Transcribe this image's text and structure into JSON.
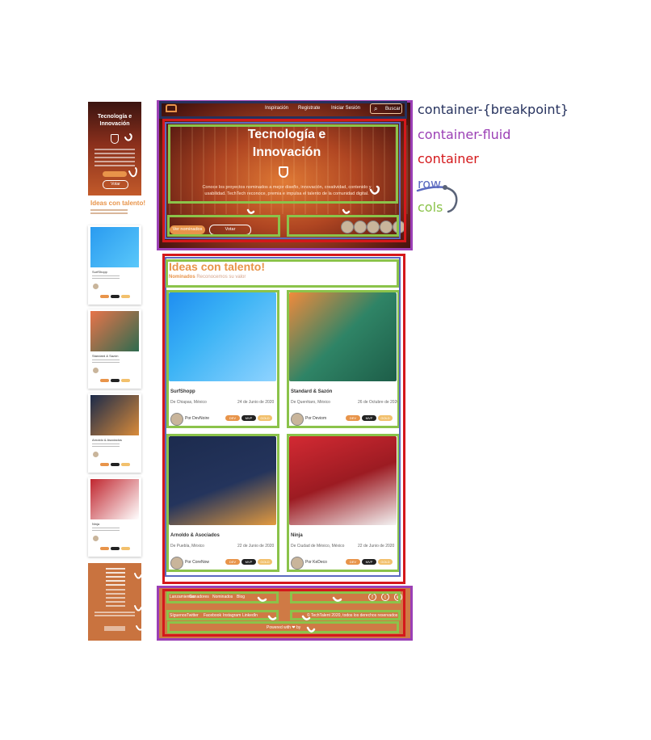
{
  "colors": {
    "container_breakpoint": "#26325e",
    "container_fluid": "#9b3fb5",
    "container": "#d4181b",
    "row": "#5b6ac0",
    "cols": "#8bc34a",
    "accent": "#e8944a"
  },
  "legend": {
    "container_breakpoint": "container-{breakpoint}",
    "container_fluid": "container-fluid",
    "container": "container",
    "row": "row",
    "cols": "cols"
  },
  "nav": {
    "items": [
      "Inspiración",
      "Registrate",
      "Iniciar Sesión"
    ],
    "search": "Buscar"
  },
  "hero": {
    "title": "Tecnología e Innovación",
    "body": "Conoce los proyectos nominados a mejor diseño, innovación, creatividad, contenido y usabilidad. TechTech reconoce, premia e impulsa el talento de la comunidad digital.",
    "primary_button": "Ver nominados",
    "secondary_button": "Votar"
  },
  "ideas": {
    "title": "Ideas con talento!",
    "subtitle_strong": "Nominados",
    "subtitle": "Reconocemos su valor"
  },
  "cards": [
    {
      "name": "SurfShopp",
      "location": "De Chiapas, México",
      "date": "24 de Junio de 2020",
      "author": "Por DevNoire"
    },
    {
      "name": "Standard & Sazón",
      "location": "De Querétaro, México",
      "date": "26 de Octubre de 2020",
      "author": "Por Deviom"
    },
    {
      "name": "Arnoldo & Asociados",
      "location": "De Puebla, México",
      "date": "22 de Junio de 2020",
      "author": "Por CoreNow"
    },
    {
      "name": "Ninja",
      "location": "De Ciudad de México, México",
      "date": "22 de Junio de 2020",
      "author": "Por KeDeco"
    }
  ],
  "badges": [
    "DEV",
    "MVP",
    "GOLD"
  ],
  "footer": {
    "links": [
      "Lanzamientos",
      "Ganadores",
      "Nominados",
      "Blog"
    ],
    "social": [
      "Síguenos",
      "Twitter",
      "Facebook",
      "Instagram",
      "LinkedIn"
    ],
    "copyright": "© TechTalent 2020, todos los derechos reservados",
    "powered": "Powered with ❤ by"
  },
  "mobile": {
    "title": "Tecnología e Innovación",
    "button": "Votar",
    "ideas_title": "Ideas con talento!",
    "card_names": [
      "SurfShopp",
      "Standard & Sazón",
      "Arnoldo & Asociados",
      "Ninja"
    ],
    "footer_links": [
      "Lanzamientos",
      "Ganadores",
      "Nominados",
      "Blog"
    ],
    "footer_social": [
      "Síguenos",
      "Twitter",
      "Facebook",
      "Instagram",
      "LinkedIn"
    ]
  }
}
